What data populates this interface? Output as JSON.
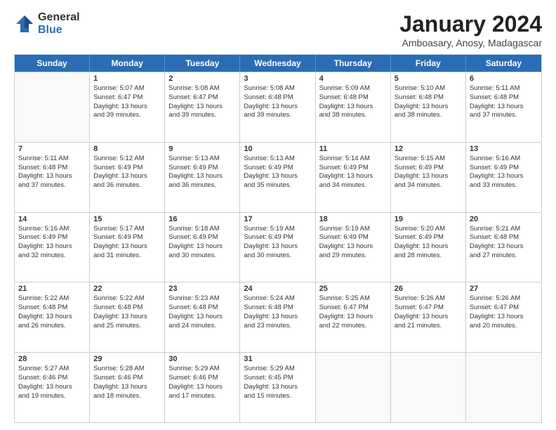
{
  "logo": {
    "general": "General",
    "blue": "Blue"
  },
  "header": {
    "month": "January 2024",
    "location": "Amboasary, Anosy, Madagascar"
  },
  "weekdays": [
    "Sunday",
    "Monday",
    "Tuesday",
    "Wednesday",
    "Thursday",
    "Friday",
    "Saturday"
  ],
  "rows": [
    [
      {
        "day": "",
        "lines": [],
        "empty": true
      },
      {
        "day": "1",
        "lines": [
          "Sunrise: 5:07 AM",
          "Sunset: 6:47 PM",
          "Daylight: 13 hours",
          "and 39 minutes."
        ]
      },
      {
        "day": "2",
        "lines": [
          "Sunrise: 5:08 AM",
          "Sunset: 6:47 PM",
          "Daylight: 13 hours",
          "and 39 minutes."
        ]
      },
      {
        "day": "3",
        "lines": [
          "Sunrise: 5:08 AM",
          "Sunset: 6:48 PM",
          "Daylight: 13 hours",
          "and 39 minutes."
        ]
      },
      {
        "day": "4",
        "lines": [
          "Sunrise: 5:09 AM",
          "Sunset: 6:48 PM",
          "Daylight: 13 hours",
          "and 38 minutes."
        ]
      },
      {
        "day": "5",
        "lines": [
          "Sunrise: 5:10 AM",
          "Sunset: 6:48 PM",
          "Daylight: 13 hours",
          "and 38 minutes."
        ]
      },
      {
        "day": "6",
        "lines": [
          "Sunrise: 5:11 AM",
          "Sunset: 6:48 PM",
          "Daylight: 13 hours",
          "and 37 minutes."
        ]
      }
    ],
    [
      {
        "day": "7",
        "lines": [
          "Sunrise: 5:11 AM",
          "Sunset: 6:48 PM",
          "Daylight: 13 hours",
          "and 37 minutes."
        ]
      },
      {
        "day": "8",
        "lines": [
          "Sunrise: 5:12 AM",
          "Sunset: 6:49 PM",
          "Daylight: 13 hours",
          "and 36 minutes."
        ]
      },
      {
        "day": "9",
        "lines": [
          "Sunrise: 5:13 AM",
          "Sunset: 6:49 PM",
          "Daylight: 13 hours",
          "and 36 minutes."
        ]
      },
      {
        "day": "10",
        "lines": [
          "Sunrise: 5:13 AM",
          "Sunset: 6:49 PM",
          "Daylight: 13 hours",
          "and 35 minutes."
        ]
      },
      {
        "day": "11",
        "lines": [
          "Sunrise: 5:14 AM",
          "Sunset: 6:49 PM",
          "Daylight: 13 hours",
          "and 34 minutes."
        ]
      },
      {
        "day": "12",
        "lines": [
          "Sunrise: 5:15 AM",
          "Sunset: 6:49 PM",
          "Daylight: 13 hours",
          "and 34 minutes."
        ]
      },
      {
        "day": "13",
        "lines": [
          "Sunrise: 5:16 AM",
          "Sunset: 6:49 PM",
          "Daylight: 13 hours",
          "and 33 minutes."
        ]
      }
    ],
    [
      {
        "day": "14",
        "lines": [
          "Sunrise: 5:16 AM",
          "Sunset: 6:49 PM",
          "Daylight: 13 hours",
          "and 32 minutes."
        ]
      },
      {
        "day": "15",
        "lines": [
          "Sunrise: 5:17 AM",
          "Sunset: 6:49 PM",
          "Daylight: 13 hours",
          "and 31 minutes."
        ]
      },
      {
        "day": "16",
        "lines": [
          "Sunrise: 5:18 AM",
          "Sunset: 6:49 PM",
          "Daylight: 13 hours",
          "and 30 minutes."
        ]
      },
      {
        "day": "17",
        "lines": [
          "Sunrise: 5:19 AM",
          "Sunset: 6:49 PM",
          "Daylight: 13 hours",
          "and 30 minutes."
        ]
      },
      {
        "day": "18",
        "lines": [
          "Sunrise: 5:19 AM",
          "Sunset: 6:49 PM",
          "Daylight: 13 hours",
          "and 29 minutes."
        ]
      },
      {
        "day": "19",
        "lines": [
          "Sunrise: 5:20 AM",
          "Sunset: 6:49 PM",
          "Daylight: 13 hours",
          "and 28 minutes."
        ]
      },
      {
        "day": "20",
        "lines": [
          "Sunrise: 5:21 AM",
          "Sunset: 6:48 PM",
          "Daylight: 13 hours",
          "and 27 minutes."
        ]
      }
    ],
    [
      {
        "day": "21",
        "lines": [
          "Sunrise: 5:22 AM",
          "Sunset: 6:48 PM",
          "Daylight: 13 hours",
          "and 26 minutes."
        ]
      },
      {
        "day": "22",
        "lines": [
          "Sunrise: 5:22 AM",
          "Sunset: 6:48 PM",
          "Daylight: 13 hours",
          "and 25 minutes."
        ]
      },
      {
        "day": "23",
        "lines": [
          "Sunrise: 5:23 AM",
          "Sunset: 6:48 PM",
          "Daylight: 13 hours",
          "and 24 minutes."
        ]
      },
      {
        "day": "24",
        "lines": [
          "Sunrise: 5:24 AM",
          "Sunset: 6:48 PM",
          "Daylight: 13 hours",
          "and 23 minutes."
        ]
      },
      {
        "day": "25",
        "lines": [
          "Sunrise: 5:25 AM",
          "Sunset: 6:47 PM",
          "Daylight: 13 hours",
          "and 22 minutes."
        ]
      },
      {
        "day": "26",
        "lines": [
          "Sunrise: 5:26 AM",
          "Sunset: 6:47 PM",
          "Daylight: 13 hours",
          "and 21 minutes."
        ]
      },
      {
        "day": "27",
        "lines": [
          "Sunrise: 5:26 AM",
          "Sunset: 6:47 PM",
          "Daylight: 13 hours",
          "and 20 minutes."
        ]
      }
    ],
    [
      {
        "day": "28",
        "lines": [
          "Sunrise: 5:27 AM",
          "Sunset: 6:46 PM",
          "Daylight: 13 hours",
          "and 19 minutes."
        ]
      },
      {
        "day": "29",
        "lines": [
          "Sunrise: 5:28 AM",
          "Sunset: 6:46 PM",
          "Daylight: 13 hours",
          "and 18 minutes."
        ]
      },
      {
        "day": "30",
        "lines": [
          "Sunrise: 5:29 AM",
          "Sunset: 6:46 PM",
          "Daylight: 13 hours",
          "and 17 minutes."
        ]
      },
      {
        "day": "31",
        "lines": [
          "Sunrise: 5:29 AM",
          "Sunset: 6:45 PM",
          "Daylight: 13 hours",
          "and 15 minutes."
        ]
      },
      {
        "day": "",
        "lines": [],
        "empty": true
      },
      {
        "day": "",
        "lines": [],
        "empty": true
      },
      {
        "day": "",
        "lines": [],
        "empty": true
      }
    ]
  ]
}
